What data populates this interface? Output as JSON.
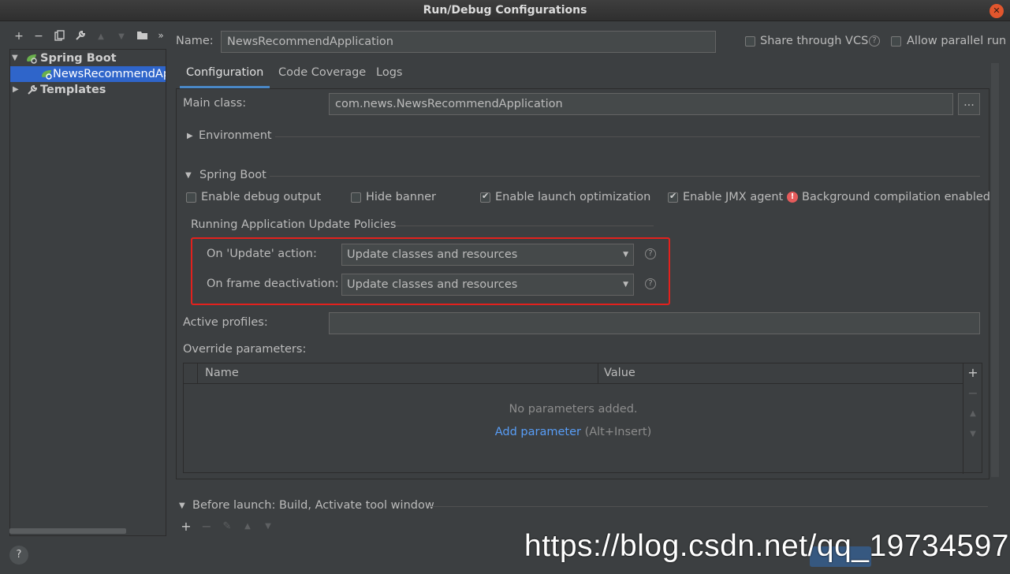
{
  "window": {
    "title": "Run/Debug Configurations"
  },
  "sidebar": {
    "items": [
      {
        "label": "Spring Boot",
        "icon": "spring-boot-icon"
      },
      {
        "label": "NewsRecommendAp",
        "icon": "spring-boot-app-icon"
      },
      {
        "label": "Templates",
        "icon": "wrench-icon"
      }
    ],
    "toolbar": [
      "+",
      "−",
      "copy",
      "wrench",
      "▲",
      "▼",
      "folder",
      "»"
    ]
  },
  "header": {
    "name_label": "Name:",
    "name_value": "NewsRecommendApplication",
    "share_vcs_label": "Share through VCS",
    "allow_parallel_label": "Allow parallel run"
  },
  "tabs": [
    {
      "label": "Configuration",
      "active": true
    },
    {
      "label": "Code Coverage",
      "active": false
    },
    {
      "label": "Logs",
      "active": false
    }
  ],
  "config": {
    "main_class_label": "Main class:",
    "main_class_value": "com.news.NewsRecommendApplication",
    "browse_label": "...",
    "environment_label": "Environment",
    "spring_boot_label": "Spring Boot",
    "enable_debug_label": "Enable debug output",
    "enable_debug_checked": false,
    "hide_banner_label": "Hide banner",
    "hide_banner_checked": false,
    "launch_opt_label": "Enable launch optimization",
    "launch_opt_checked": true,
    "jmx_label": "Enable JMX agent",
    "jmx_checked": true,
    "bg_compilation_label": "Background compilation enabled",
    "policies_label": "Running Application Update Policies",
    "on_update_label": "On 'Update' action:",
    "on_update_value": "Update classes and resources",
    "on_frame_label": "On frame deactivation:",
    "on_frame_value": "Update classes and resources",
    "active_profiles_label": "Active profiles:",
    "active_profiles_value": "",
    "override_label": "Override parameters:",
    "table": {
      "columns": [
        "Name",
        "Value"
      ],
      "empty_text": "No parameters added.",
      "add_link": "Add parameter",
      "add_shortcut": " (Alt+Insert)"
    }
  },
  "before_launch": {
    "label": "Before launch: Build, Activate tool window"
  },
  "watermark": "https://blog.csdn.net/qq_19734597",
  "colors": {
    "accent": "#2f65ca",
    "link": "#589df6",
    "highlight_box": "#e3211d",
    "warning": "#e55b5b"
  }
}
